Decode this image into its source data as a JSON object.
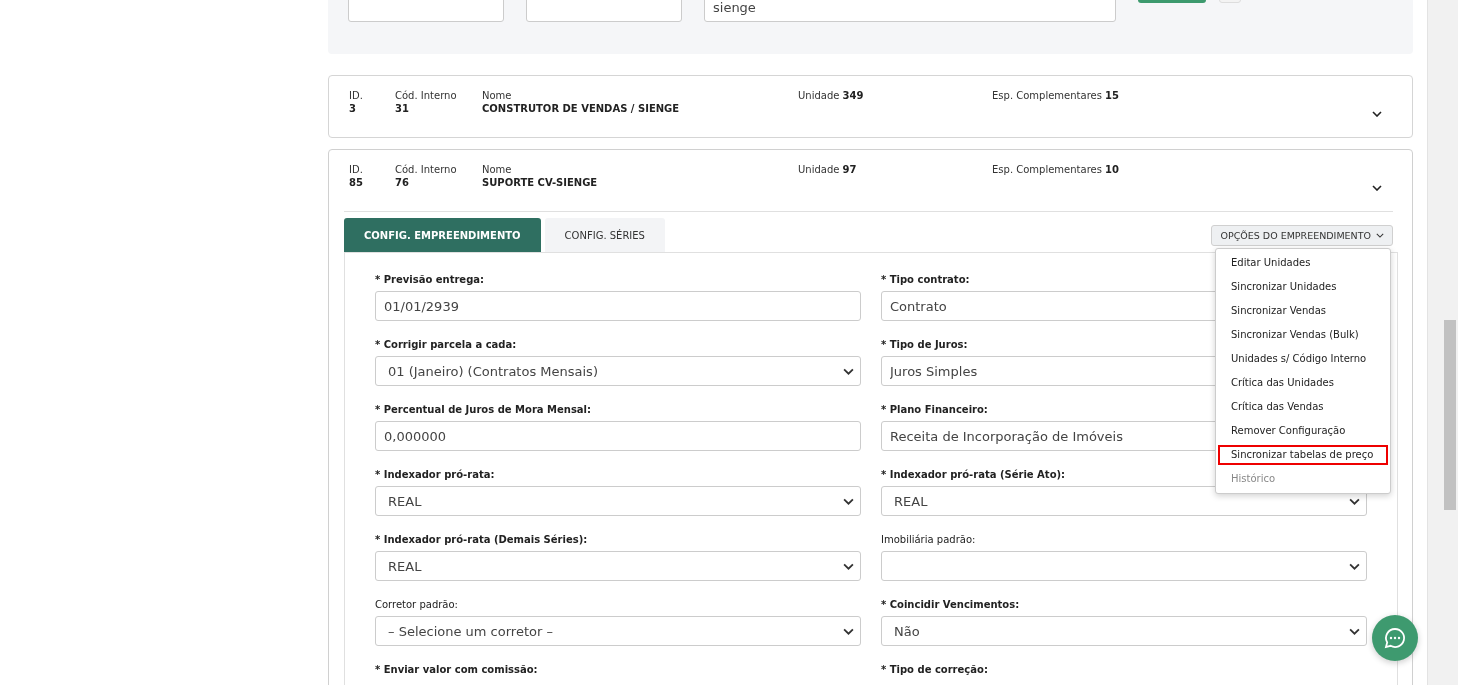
{
  "filters": {
    "fields": [
      {
        "kind": "text"
      },
      {
        "kind": "text"
      },
      {
        "kind": "text",
        "value": "sienge"
      }
    ],
    "buttons": [
      {
        "kind": "primary"
      },
      {
        "kind": "secondary"
      }
    ]
  },
  "projects": [
    {
      "id_label": "ID.",
      "id": "3",
      "code_label": "Cód. Interno",
      "code": "31",
      "name_label": "Nome",
      "name": "CONSTRUTOR DE VENDAS / SIENGE",
      "units_label": "Unidade",
      "units": "349",
      "extras_label": "Esp. Complementares",
      "extras": "15",
      "expanded": false
    },
    {
      "id_label": "ID.",
      "id": "85",
      "code_label": "Cód. Interno",
      "code": "76",
      "name_label": "Nome",
      "name": "SUPORTE CV-SIENGE",
      "units_label": "Unidade",
      "units": "97",
      "extras_label": "Esp. Complementares",
      "extras": "10",
      "expanded": true
    }
  ],
  "tabs": [
    {
      "label": "CONFIG. EMPREENDIMENTO",
      "selected": true
    },
    {
      "label": "CONFIG. SÉRIES",
      "selected": false
    }
  ],
  "options_menu": {
    "label": "OPÇÕES DO EMPREENDIMENTO",
    "expanded": true,
    "items": [
      {
        "label": "Editar Unidades",
        "highlighted": false,
        "disabled": false
      },
      {
        "label": "Sincronizar Unidades",
        "highlighted": false,
        "disabled": false
      },
      {
        "label": "Sincronizar Vendas",
        "highlighted": false,
        "disabled": false
      },
      {
        "label": "Sincronizar Vendas (Bulk)",
        "highlighted": false,
        "disabled": false
      },
      {
        "label": "Unidades s/ Código Interno",
        "highlighted": false,
        "disabled": false
      },
      {
        "label": "Crítica das Unidades",
        "highlighted": false,
        "disabled": false
      },
      {
        "label": "Crítica das Vendas",
        "highlighted": false,
        "disabled": false
      },
      {
        "label": "Remover Configuração",
        "highlighted": false,
        "disabled": false
      },
      {
        "label": "Sincronizar tabelas de preço",
        "highlighted": true,
        "disabled": false
      },
      {
        "label": "Histórico",
        "highlighted": false,
        "disabled": true
      }
    ]
  },
  "form_fields": [
    {
      "label": "* Previsão entrega:",
      "required": true,
      "kind": "input",
      "value": "01/01/2939"
    },
    {
      "label": "* Tipo contrato:",
      "required": true,
      "kind": "input",
      "value": "Contrato"
    },
    {
      "label": "* Corrigir parcela a cada:",
      "required": true,
      "kind": "select",
      "value": "01 (Janeiro) (Contratos Mensais)"
    },
    {
      "label": "* Tipo de Juros:",
      "required": true,
      "kind": "input",
      "value": "Juros Simples"
    },
    {
      "label": "* Percentual de Juros de Mora Mensal:",
      "required": true,
      "kind": "input",
      "value": "0,000000"
    },
    {
      "label": "* Plano Financeiro:",
      "required": true,
      "kind": "input",
      "value": "Receita de Incorporação de Imóveis"
    },
    {
      "label": "* Indexador pró-rata:",
      "required": true,
      "kind": "select",
      "value": "REAL"
    },
    {
      "label": "* Indexador pró-rata (Série Ato):",
      "required": true,
      "kind": "select",
      "value": "REAL"
    },
    {
      "label": "* Indexador pró-rata (Demais Séries):",
      "required": true,
      "kind": "select",
      "value": "REAL"
    },
    {
      "label": "Imobiliária padrão:",
      "required": false,
      "kind": "select"
    },
    {
      "label": "Corretor padrão:",
      "required": false,
      "kind": "select",
      "value": "– Selecione um corretor –"
    },
    {
      "label": "* Coincidir Vencimentos:",
      "required": true,
      "kind": "select",
      "value": "Não"
    },
    {
      "label": "* Enviar valor com comissão:",
      "required": true,
      "kind": "none"
    },
    {
      "label": "* Tipo de correção:",
      "required": true,
      "kind": "none"
    }
  ]
}
